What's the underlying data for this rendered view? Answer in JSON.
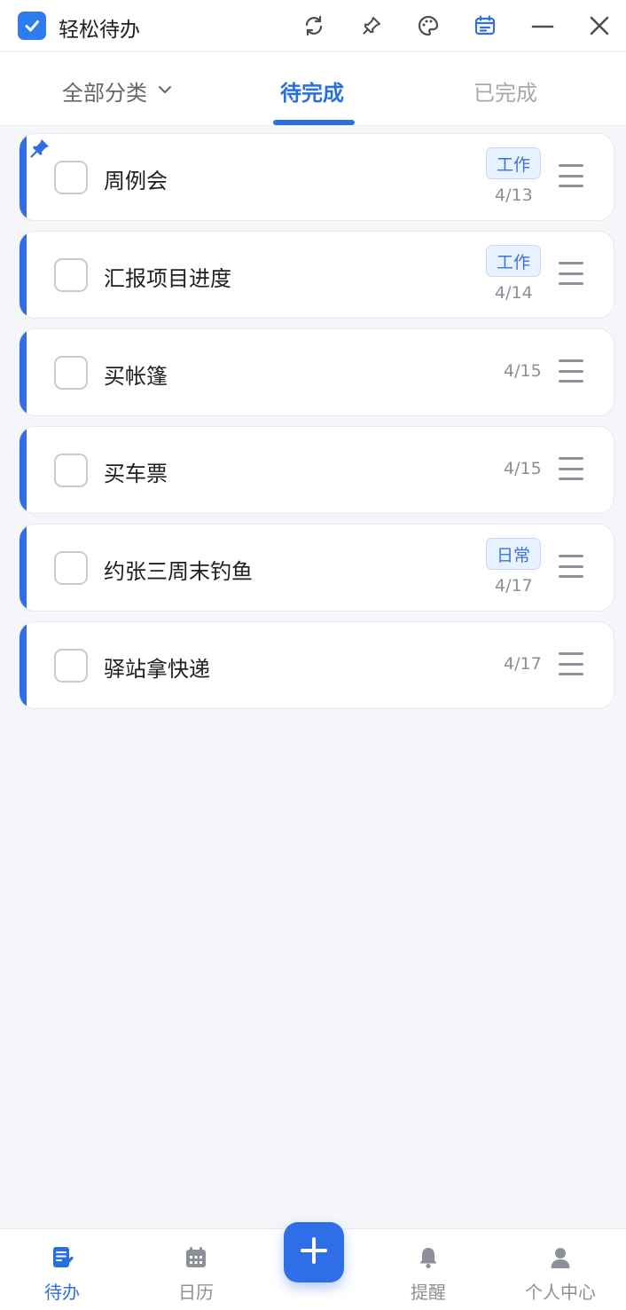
{
  "app": {
    "title": "轻松待办",
    "accent_color": "#2f6ee6"
  },
  "titlebar": {
    "icons": [
      "check-logo-icon",
      "sync-icon",
      "pin-icon",
      "palette-icon",
      "calendar-icon",
      "minimize-icon",
      "close-icon"
    ]
  },
  "tabs": {
    "category_label": "全部分类",
    "pending_label": "待完成",
    "done_label": "已完成",
    "active": "pending"
  },
  "todos": [
    {
      "title": "周例会",
      "tag": "工作",
      "date": "4/13",
      "pinned": true
    },
    {
      "title": "汇报项目进度",
      "tag": "工作",
      "date": "4/14",
      "pinned": false
    },
    {
      "title": "买帐篷",
      "tag": "",
      "date": "4/15",
      "pinned": false
    },
    {
      "title": "买车票",
      "tag": "",
      "date": "4/15",
      "pinned": false
    },
    {
      "title": "约张三周末钓鱼",
      "tag": "日常",
      "date": "4/17",
      "pinned": false
    },
    {
      "title": "驿站拿快递",
      "tag": "",
      "date": "4/17",
      "pinned": false
    }
  ],
  "bottom_nav": {
    "todo_label": "待办",
    "calendar_label": "日历",
    "reminder_label": "提醒",
    "profile_label": "个人中心",
    "active": "todo"
  }
}
